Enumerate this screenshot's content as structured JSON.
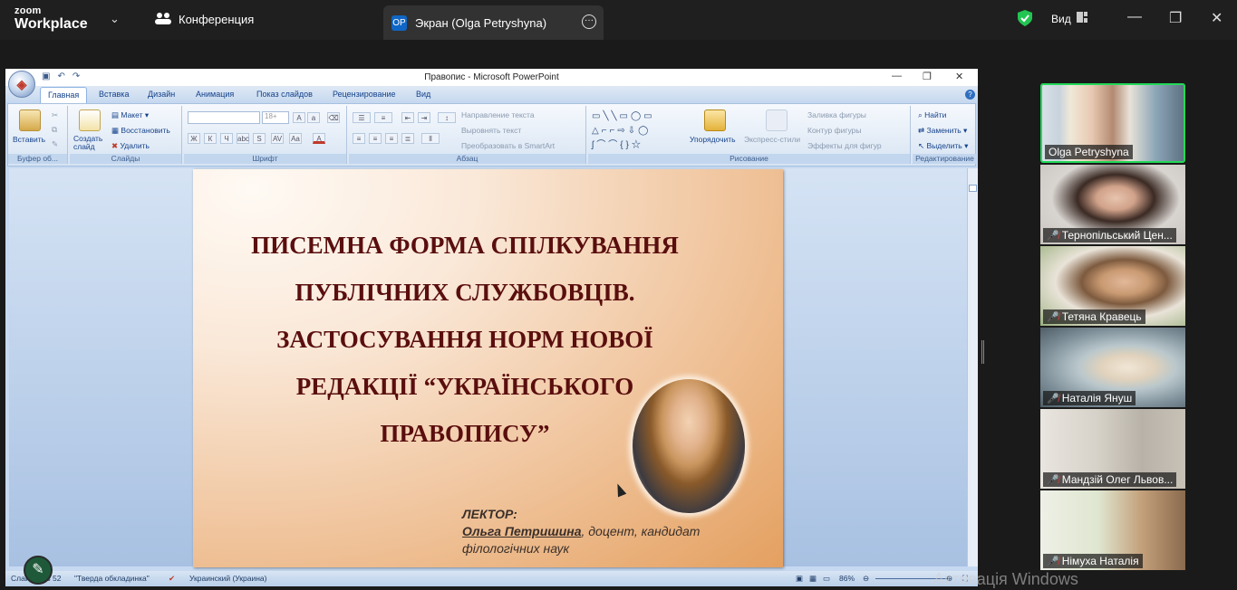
{
  "zoom": {
    "logo_top": "zoom",
    "logo_bottom": "Workplace",
    "meeting_label": "Конференция",
    "share_tab_initials": "OP",
    "share_tab_label": "Экран (Olga Petryshyna)",
    "view_label": "Вид"
  },
  "ppt": {
    "window_title": "Правопис - Microsoft PowerPoint",
    "tabs": [
      "Главная",
      "Вставка",
      "Дизайн",
      "Анимация",
      "Показ слайдов",
      "Рецензирование",
      "Вид"
    ],
    "ribbon": {
      "paste": "Вставить",
      "new_slide": "Создать слайд",
      "layout": "Макет",
      "reset": "Восстановить",
      "delete": "Удалить",
      "font_size": "18+",
      "text_direction": "Направление текста",
      "align_text": "Выровнять текст",
      "smartart": "Преобразовать в SmartArt",
      "arrange": "Упорядочить",
      "quick_styles": "Экспресс-стили",
      "shape_fill": "Заливка фигуры",
      "shape_outline": "Контур фигуры",
      "shape_effects": "Эффекты для фигур",
      "find": "Найти",
      "replace": "Заменить",
      "select": "Выделить",
      "groups": [
        "Буфер об...",
        "Слайды",
        "Шрифт",
        "Абзац",
        "Рисование",
        "Редактирование"
      ]
    },
    "slide": {
      "title_lines": [
        "ПИСЕМНА ФОРМА СПІЛКУВАННЯ",
        "ПУБЛІЧНИХ СЛУЖБОВЦІВ.",
        "ЗАСТОСУВАННЯ НОРМ НОВОЇ",
        "РЕДАКЦІЇ “УКРАЇНСЬКОГО",
        "ПРАВОПИСУ”"
      ],
      "lector_label": "ЛЕКТОР:",
      "lector_name": "Ольга Петришина",
      "lector_rest": ", доцент, кандидат",
      "lector_line3": "філологічних наук"
    },
    "status": {
      "slide_num": "Слайд 1 из 52",
      "theme": "\"Тверда обкладинка\"",
      "language": "Украинский (Украина)",
      "zoom": "86%"
    }
  },
  "participants": [
    {
      "name": "Olga Petryshyna",
      "muted": false,
      "active": true
    },
    {
      "name": "Тернопільський Цен...",
      "muted": true,
      "active": false
    },
    {
      "name": "Тетяна Кравець",
      "muted": true,
      "active": false
    },
    {
      "name": "Наталія Януш",
      "muted": true,
      "active": false
    },
    {
      "name": "Мандзій Олег Львов...",
      "muted": true,
      "active": false
    },
    {
      "name": "Німуха Наталія",
      "muted": true,
      "active": false
    }
  ],
  "watermark": "Активація Windows"
}
